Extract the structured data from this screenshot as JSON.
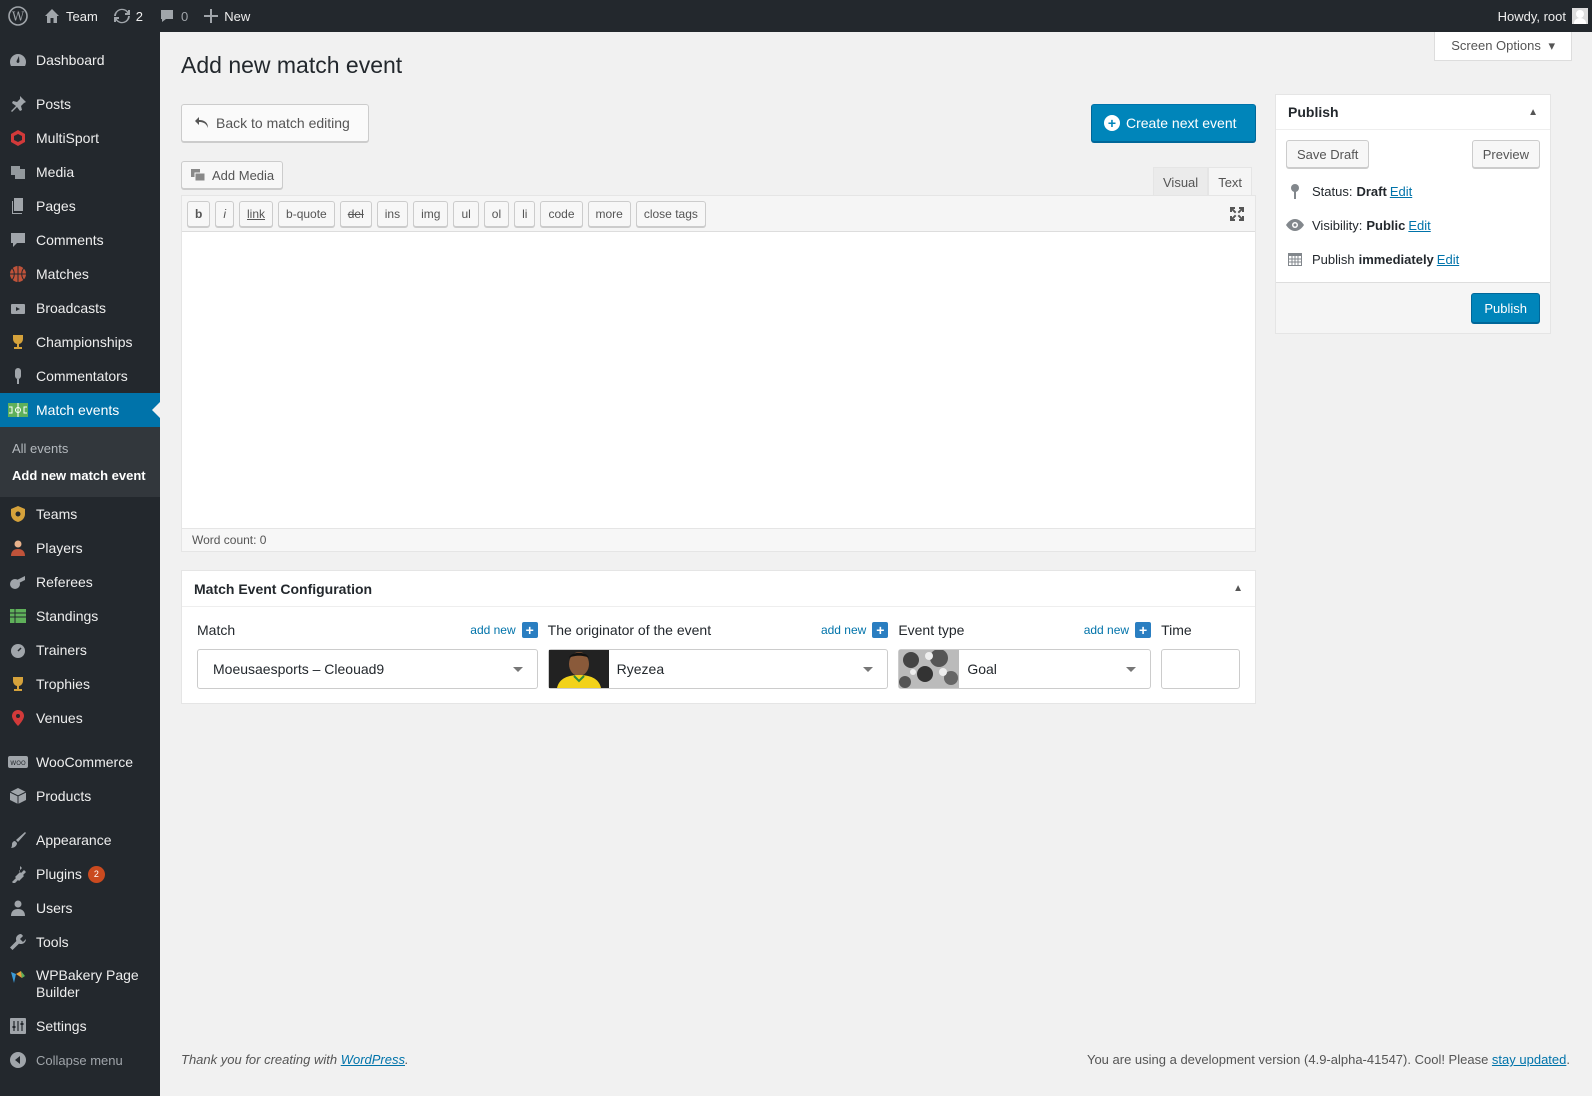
{
  "adminbar": {
    "site_name": "Team",
    "updates_count": "2",
    "comments_count": "0",
    "new_label": "New",
    "howdy": "Howdy, root"
  },
  "sidebar": {
    "items": [
      {
        "label": "Dashboard",
        "icon": "dashboard-icon"
      },
      {
        "label": "Posts",
        "icon": "pin-icon"
      },
      {
        "label": "MultiSport",
        "icon": "multisport-icon"
      },
      {
        "label": "Media",
        "icon": "media-icon"
      },
      {
        "label": "Pages",
        "icon": "pages-icon"
      },
      {
        "label": "Comments",
        "icon": "comments-icon"
      },
      {
        "label": "Matches",
        "icon": "basketball-icon"
      },
      {
        "label": "Broadcasts",
        "icon": "broadcast-icon"
      },
      {
        "label": "Championships",
        "icon": "trophy-icon"
      },
      {
        "label": "Commentators",
        "icon": "microphone-icon"
      },
      {
        "label": "Match events",
        "icon": "field-icon"
      },
      {
        "label": "Teams",
        "icon": "shield-icon"
      },
      {
        "label": "Players",
        "icon": "player-icon"
      },
      {
        "label": "Referees",
        "icon": "whistle-icon"
      },
      {
        "label": "Standings",
        "icon": "table-icon"
      },
      {
        "label": "Trainers",
        "icon": "stopwatch-icon"
      },
      {
        "label": "Trophies",
        "icon": "trophy-icon"
      },
      {
        "label": "Venues",
        "icon": "location-icon"
      },
      {
        "label": "WooCommerce",
        "icon": "woo-icon"
      },
      {
        "label": "Products",
        "icon": "box-icon"
      },
      {
        "label": "Appearance",
        "icon": "brush-icon"
      },
      {
        "label": "Plugins",
        "icon": "plugin-icon",
        "badge": "2"
      },
      {
        "label": "Users",
        "icon": "user-icon"
      },
      {
        "label": "Tools",
        "icon": "wrench-icon"
      },
      {
        "label": "WPBakery Page Builder",
        "icon": "wpbakery-icon"
      },
      {
        "label": "Settings",
        "icon": "settings-icon"
      },
      {
        "label": "Collapse menu",
        "icon": "collapse-icon"
      }
    ],
    "submenu": [
      "All events",
      "Add new match event"
    ]
  },
  "header": {
    "screen_options": "Screen Options",
    "page_title": "Add new match event"
  },
  "actions": {
    "back": "Back to match editing",
    "create_next": "Create next event"
  },
  "editor": {
    "add_media": "Add Media",
    "tab_visual": "Visual",
    "tab_text": "Text",
    "quicktags": [
      "b",
      "i",
      "link",
      "b-quote",
      "del",
      "ins",
      "img",
      "ul",
      "ol",
      "li",
      "code",
      "more",
      "close tags"
    ],
    "word_count": "Word count: 0"
  },
  "config": {
    "title": "Match Event Configuration",
    "match_label": "Match",
    "match_value": "Moeusaesports – Cleouad9",
    "originator_label": "The originator of the event",
    "originator_value": "Ryezea",
    "event_type_label": "Event type",
    "event_type_value": "Goal",
    "time_label": "Time",
    "time_value": "",
    "add_new": "add new"
  },
  "publish": {
    "title": "Publish",
    "save_draft": "Save Draft",
    "preview": "Preview",
    "status_label": "Status:",
    "status_value": "Draft",
    "visibility_label": "Visibility:",
    "visibility_value": "Public",
    "publish_label": "Publish",
    "publish_value": "immediately",
    "edit": "Edit",
    "publish_button": "Publish"
  },
  "footer": {
    "thanks_prefix": "Thank you for creating with ",
    "thanks_link": "WordPress",
    "thanks_suffix": ".",
    "version_text": "You are using a development version (4.9-alpha-41547). Cool! Please ",
    "version_link": "stay updated",
    "version_suffix": "."
  }
}
